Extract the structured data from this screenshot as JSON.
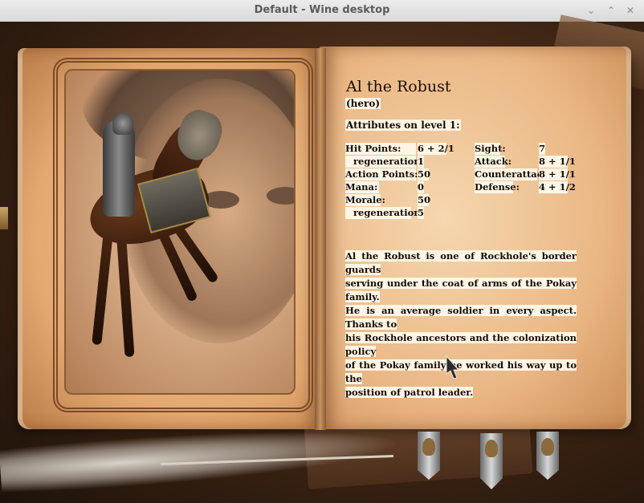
{
  "window": {
    "title": "Default - Wine desktop",
    "minimize_glyph": "⌄",
    "maximize_glyph": "⌃",
    "close_glyph": "✕"
  },
  "hero": {
    "name": "Al the Robust",
    "class": "(hero)",
    "attributes_title": "Attributes on level 1:"
  },
  "stats_left": [
    {
      "label": "Hit Points:",
      "value": "6 + 2/1"
    },
    {
      "label": "regeneration",
      "value": "1"
    },
    {
      "label": "Action Points:",
      "value": "50"
    },
    {
      "label": "Mana:",
      "value": "0"
    },
    {
      "label": "Morale:",
      "value": "50"
    },
    {
      "label": "regeneration",
      "value": "5"
    }
  ],
  "stats_right": [
    {
      "label": "Sight:",
      "value": "7"
    },
    {
      "label": "Attack:",
      "value": "8 + 1/1"
    },
    {
      "label": "Counterattack:",
      "value": "8 + 1/1"
    },
    {
      "label": "Defense:",
      "value": "4 + 1/2"
    }
  ],
  "description": [
    "Al the Robust is one of Rockhole's border guards",
    "serving under the coat of arms of the Pokay family.",
    "He is an average soldier in every aspect. Thanks to",
    "his Rockhole ancestors and the colonization policy",
    "of the Pokay family he worked his way up to the",
    "position of patrol leader."
  ],
  "icons": {
    "cursor": "arrow-cursor-icon",
    "tabs": [
      "bookmark-tab-icon",
      "bookmark-tab-icon",
      "bookmark-tab-icon"
    ]
  },
  "colors": {
    "page": "#eab784",
    "text_bg": "#fff6e6",
    "ink": "#140a04"
  }
}
